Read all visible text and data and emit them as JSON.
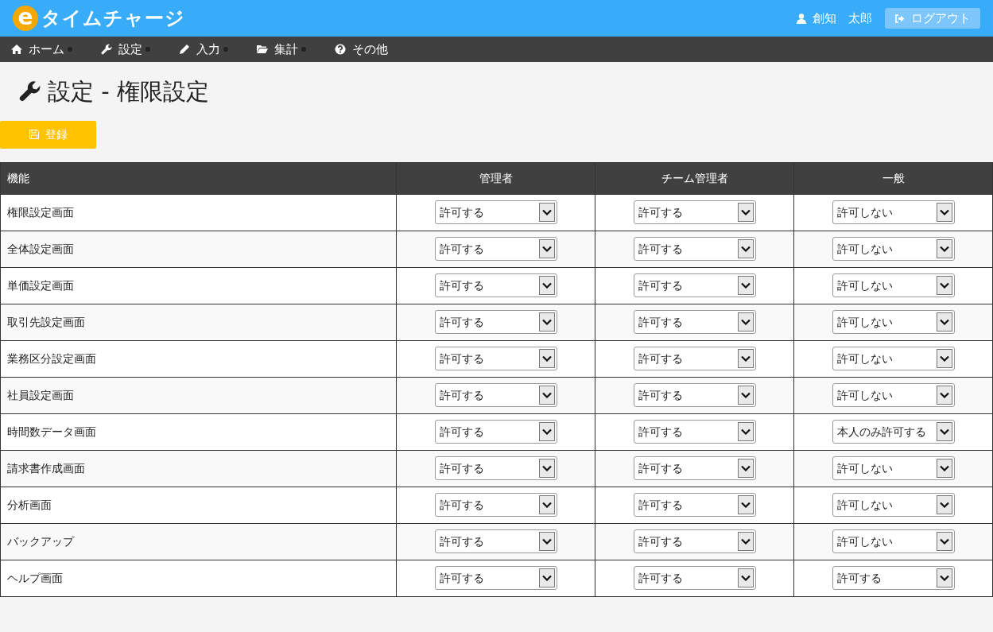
{
  "header": {
    "logo_mark": "e",
    "logo_text": "タイムチャージ",
    "user_name": "創知　太郎",
    "logout_label": "ログアウト"
  },
  "nav": [
    {
      "label": "ホーム"
    },
    {
      "label": "設定"
    },
    {
      "label": "入力"
    },
    {
      "label": "集計"
    },
    {
      "label": "その他"
    }
  ],
  "page_title": "設定 - 権限設定",
  "register_button": "登録",
  "table": {
    "columns": [
      "機能",
      "管理者",
      "チーム管理者",
      "一般"
    ],
    "rows": [
      {
        "feature": "権限設定画面",
        "values": [
          "許可する",
          "許可する",
          "許可しない"
        ]
      },
      {
        "feature": "全体設定画面",
        "values": [
          "許可する",
          "許可する",
          "許可しない"
        ]
      },
      {
        "feature": "単価設定画面",
        "values": [
          "許可する",
          "許可する",
          "許可しない"
        ]
      },
      {
        "feature": "取引先設定画面",
        "values": [
          "許可する",
          "許可する",
          "許可しない"
        ]
      },
      {
        "feature": "業務区分設定画面",
        "values": [
          "許可する",
          "許可する",
          "許可しない"
        ]
      },
      {
        "feature": "社員設定画面",
        "values": [
          "許可する",
          "許可する",
          "許可しない"
        ]
      },
      {
        "feature": "時間数データ画面",
        "values": [
          "許可する",
          "許可する",
          "本人のみ許可する"
        ]
      },
      {
        "feature": "請求書作成画面",
        "values": [
          "許可する",
          "許可する",
          "許可しない"
        ]
      },
      {
        "feature": "分析画面",
        "values": [
          "許可する",
          "許可する",
          "許可しない"
        ]
      },
      {
        "feature": "バックアップ",
        "values": [
          "許可する",
          "許可する",
          "許可しない"
        ]
      },
      {
        "feature": "ヘルプ画面",
        "values": [
          "許可する",
          "許可する",
          "許可する"
        ]
      }
    ]
  }
}
